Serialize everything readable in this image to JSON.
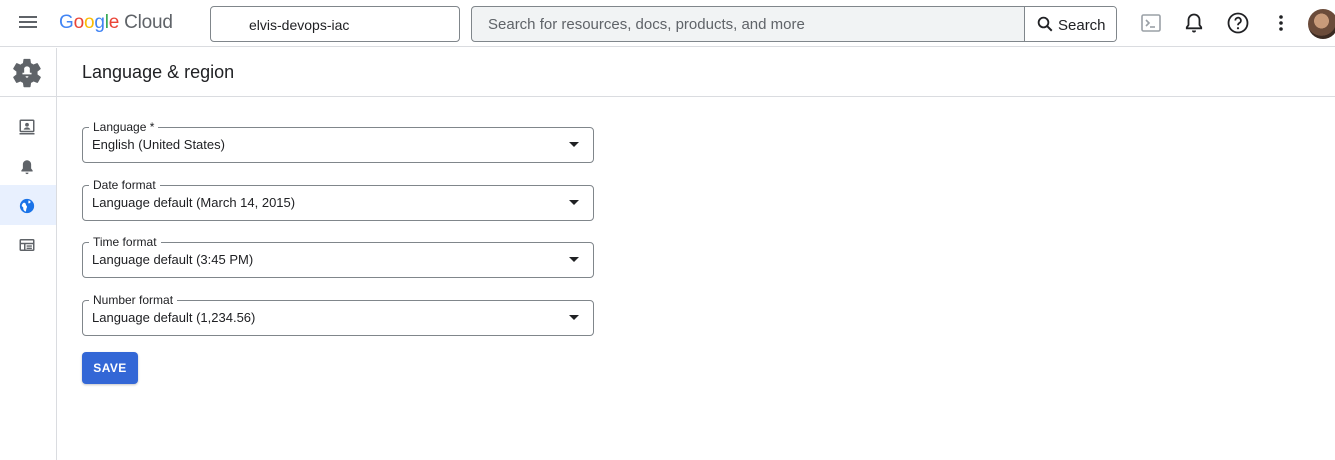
{
  "header": {
    "logo_letters": [
      "G",
      "o",
      "o",
      "g",
      "l",
      "e"
    ],
    "logo_product": "Cloud",
    "project_name": "elvis-devops-iac",
    "search_placeholder": "Search for resources, docs, products, and more",
    "search_button_label": "Search",
    "icons": [
      "menu-icon",
      "cloud-shell-icon",
      "notifications-icon",
      "help-icon",
      "more-vert-icon",
      "account-avatar"
    ]
  },
  "sidebar": {
    "icons": [
      "settings-gear-icon",
      "account-card-icon",
      "notifications-icon",
      "language-globe-icon",
      "table-icon"
    ],
    "active_item": "language-globe-icon"
  },
  "page": {
    "title": "Language & region"
  },
  "form": {
    "fields": [
      {
        "label": "Language *",
        "value": "English (United States)"
      },
      {
        "label": "Date format",
        "value": "Language default (March 14, 2015)"
      },
      {
        "label": "Time format",
        "value": "Language default (3:45 PM)"
      },
      {
        "label": "Number format",
        "value": "Language default (1,234.56)"
      }
    ],
    "save_label": "SAVE"
  },
  "colors": {
    "accent": "#3367d6",
    "border": "#dadce0",
    "active_nav_bg": "#e8f0fe"
  }
}
